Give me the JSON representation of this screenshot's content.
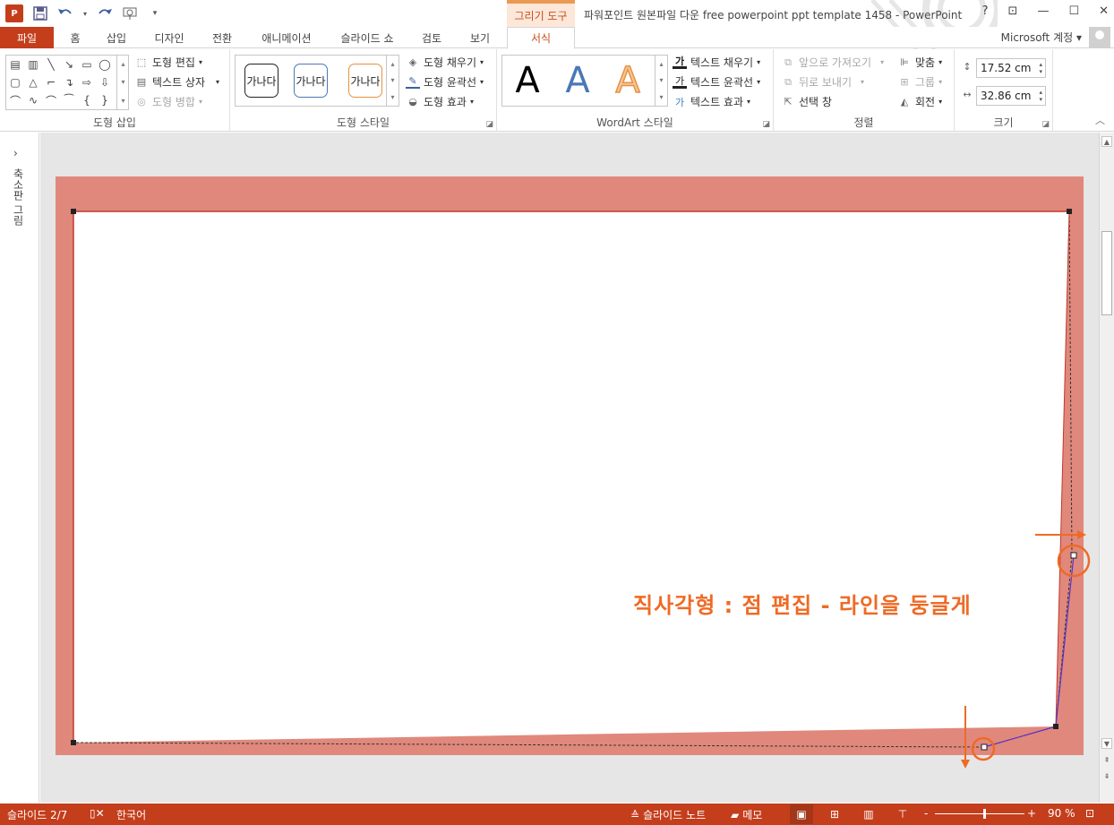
{
  "titlebar": {
    "app_icon": "P",
    "context_tab": "그리기 도구",
    "window_title": "파워포인트 원본파일 다운 free powerpoint ppt template 1458 - PowerPoint",
    "help": "?",
    "controls": [
      "restore-ribbon-icon",
      "minimize-icon",
      "maximize-icon",
      "close-icon"
    ]
  },
  "tabs": {
    "file": "파일",
    "items": [
      "홈",
      "삽입",
      "디자인",
      "전환",
      "애니메이션",
      "슬라이드 쇼",
      "검토",
      "보기"
    ],
    "active": "서식",
    "account": "Microsoft 계정"
  },
  "ribbon": {
    "insert_shapes": {
      "label": "도형 삽입",
      "edit_shape": "도형 편집",
      "text_box": "텍스트 상자",
      "merge_shapes": "도형 병합"
    },
    "shape_styles": {
      "label": "도형 스타일",
      "samples": [
        "가나다",
        "가나다",
        "가나다"
      ],
      "fill": "도형 채우기",
      "outline": "도형 윤곽선",
      "effects": "도형 효과"
    },
    "wordart": {
      "label": "WordArt 스타일",
      "letters": [
        "A",
        "A",
        "A"
      ],
      "text_fill": "텍스트 채우기",
      "text_outline": "텍스트 윤곽선",
      "text_effects": "텍스트 효과",
      "icon_fill": "가",
      "icon_outline": "가",
      "icon_effects": "가"
    },
    "arrange": {
      "label": "정렬",
      "bring_forward": "앞으로 가져오기",
      "send_backward": "뒤로 보내기",
      "selection_pane": "선택 창",
      "align": "맞춤",
      "group": "그룹",
      "rotate": "회전"
    },
    "size": {
      "label": "크기",
      "height": "17.52 cm",
      "width": "32.86 cm"
    }
  },
  "thumbnail_pane": {
    "label": "축소판 그림"
  },
  "canvas": {
    "annotation": "직사각형 : 점 편집 - 라인을 둥글게",
    "annotation_color": "#ef6a24",
    "slide_color": "#e0887c"
  },
  "statusbar": {
    "slide_info": "슬라이드 2/7",
    "language": "한국어",
    "notes": "슬라이드 노트",
    "comments": "메모",
    "zoom_minus": "-",
    "zoom_plus": "+",
    "zoom": "90 %",
    "zoom_fraction": 0.55
  }
}
